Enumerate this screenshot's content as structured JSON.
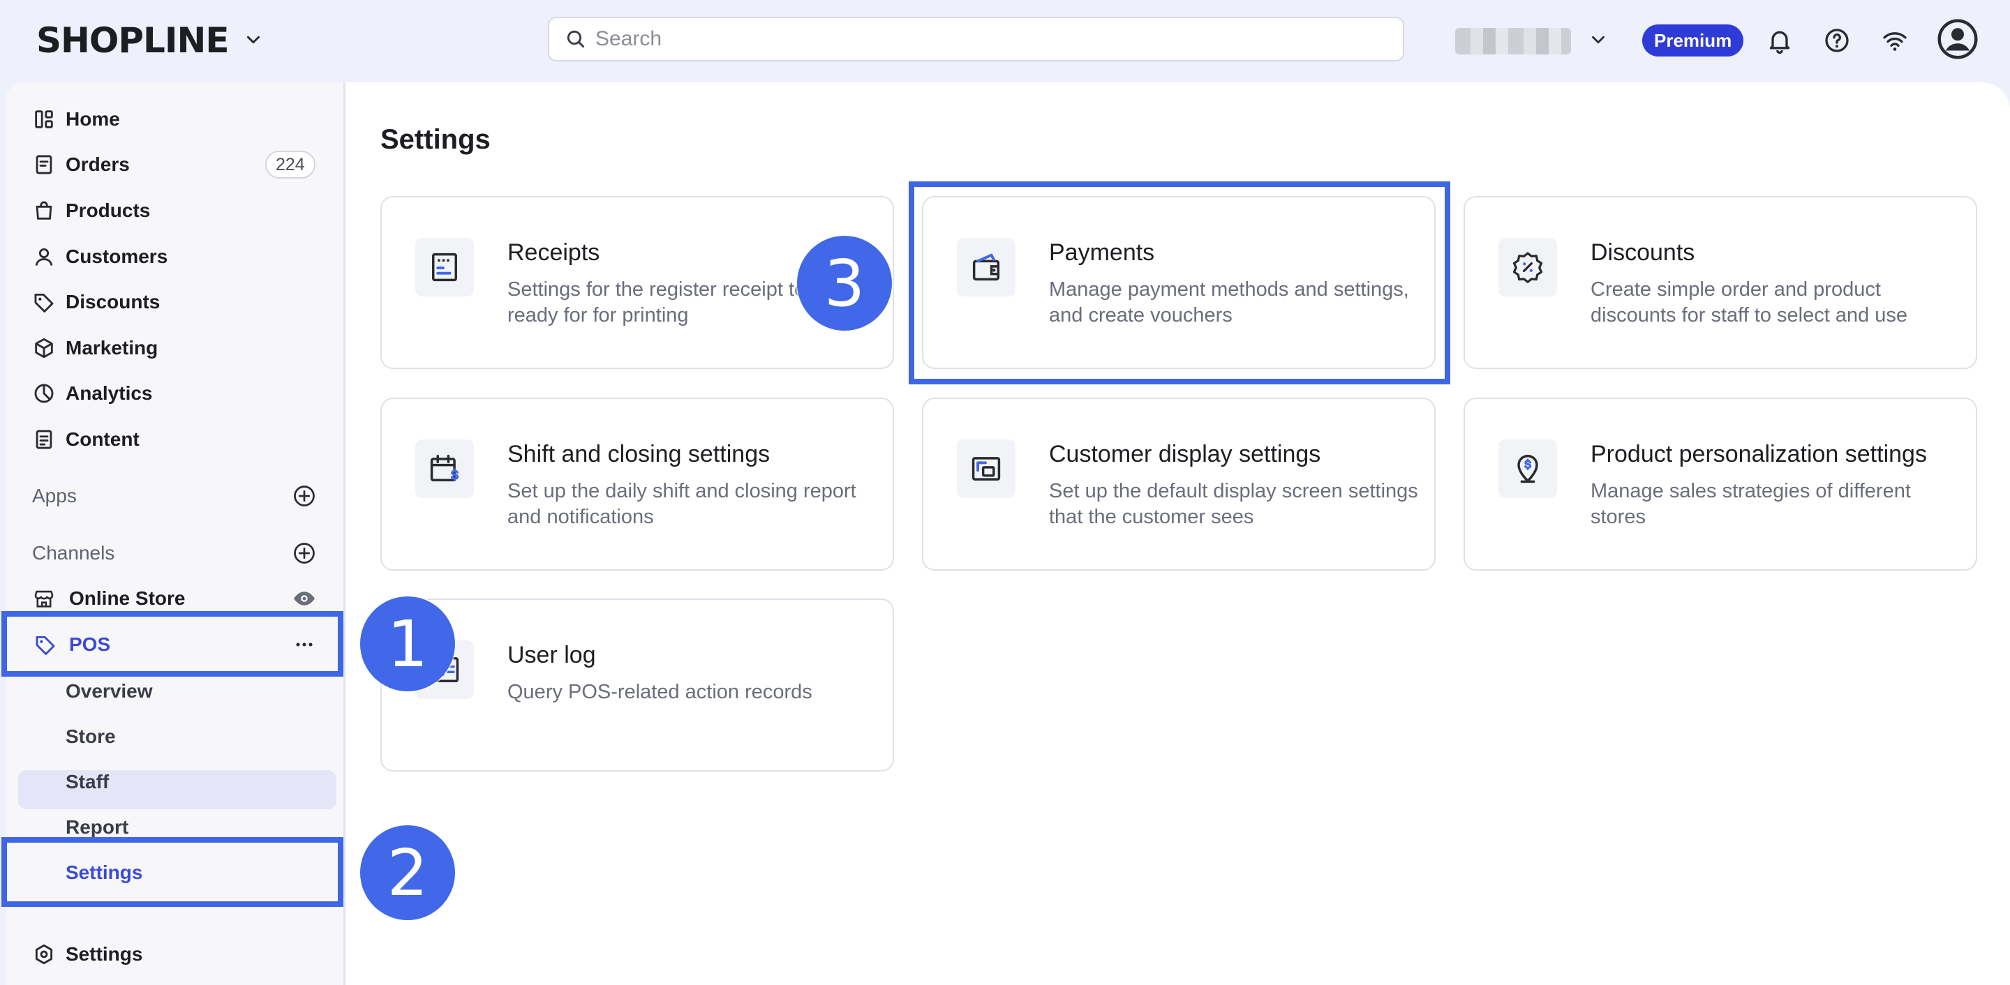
{
  "app": {
    "logo": "SHOPLINE"
  },
  "search": {
    "placeholder": "Search"
  },
  "header": {
    "premium_label": "Premium"
  },
  "sidebar": {
    "items": [
      {
        "label": "Home",
        "icon": "layout-icon"
      },
      {
        "label": "Orders",
        "icon": "orders-icon",
        "count": "224"
      },
      {
        "label": "Products",
        "icon": "bag-icon"
      },
      {
        "label": "Customers",
        "icon": "person-icon"
      },
      {
        "label": "Discounts",
        "icon": "tag-icon"
      },
      {
        "label": "Marketing",
        "icon": "cube-icon"
      },
      {
        "label": "Analytics",
        "icon": "pie-chart-icon"
      },
      {
        "label": "Content",
        "icon": "document-icon"
      }
    ],
    "apps_label": "Apps",
    "channels_label": "Channels",
    "online_store_label": "Online Store",
    "pos_label": "POS",
    "pos_subitems": [
      "Overview",
      "Store",
      "Staff",
      "Report",
      "Settings"
    ],
    "settings_label": "Settings"
  },
  "main": {
    "title": "Settings",
    "cards": [
      {
        "title": "Receipts",
        "desc": "Settings for the register receipt templates ready for for printing",
        "icon": "receipt-icon"
      },
      {
        "title": "Payments",
        "desc": "Manage payment methods and settings, and create vouchers",
        "icon": "wallet-icon"
      },
      {
        "title": "Discounts",
        "desc": "Create simple order and product discounts for staff to select and use",
        "icon": "discount-badge-icon"
      },
      {
        "title": "Shift and closing settings",
        "desc": "Set up the daily shift and closing report and notifications",
        "icon": "calendar-dollar-icon"
      },
      {
        "title": "Customer display settings",
        "desc": "Set up the default display screen settings that the customer sees",
        "icon": "display-icon"
      },
      {
        "title": "Product personalization settings",
        "desc": "Manage sales strategies of different stores",
        "icon": "location-dollar-icon"
      },
      {
        "title": "User log",
        "desc": "Query POS-related action records",
        "icon": "user-log-icon"
      }
    ]
  },
  "annotations": {
    "step1": "1",
    "step2": "2",
    "step3": "3"
  },
  "colors": {
    "accent": "#2f3bd6",
    "highlight": "#3f66e6",
    "step_badge": "#4068e8",
    "active_text": "#3b4bd4"
  }
}
